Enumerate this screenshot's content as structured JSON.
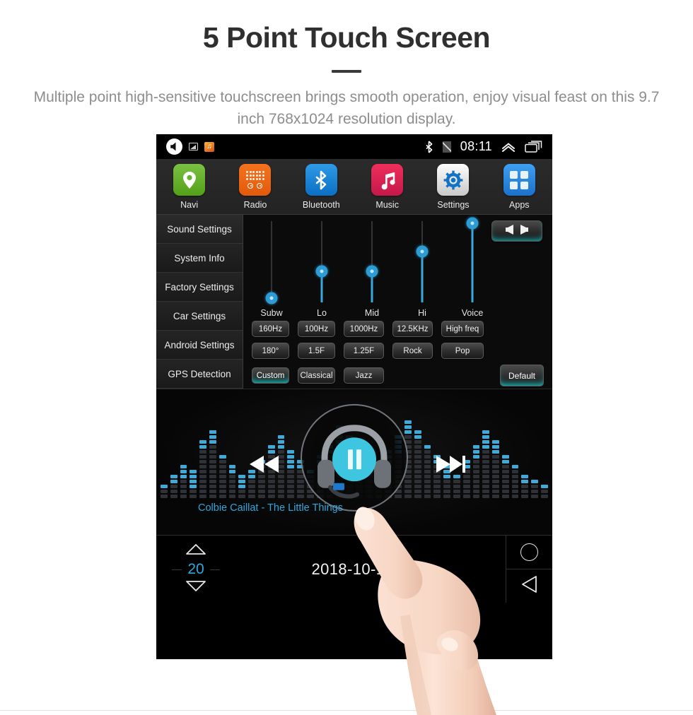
{
  "hero": {
    "title": "5 Point Touch Screen",
    "subtitle": "Multiple point high-sensitive touchscreen brings smooth operation, enjoy visual feast on this 9.7 inch 768x1024 resolution display."
  },
  "colors": {
    "accent_blue": "#2fa8e0",
    "slider_blue": "#2e9cd4",
    "glow_teal": "#1ad0d0",
    "screen_bg": "#000000"
  },
  "device": {
    "statusbar": {
      "mute_icon": "speaker-mute-icon",
      "sd_icon": "sd-card-icon",
      "music_icon": "music-notification-icon",
      "bluetooth_icon": "bluetooth-icon",
      "signal_icon": "no-sim-icon",
      "clock": "08:11",
      "expand_icon": "chevron-up-icon",
      "recents_icon": "recents-icon"
    },
    "apps": [
      {
        "label": "Navi",
        "icon": "location-pin-icon"
      },
      {
        "label": "Radio",
        "icon": "radio-icon"
      },
      {
        "label": "Bluetooth",
        "icon": "bluetooth-icon"
      },
      {
        "label": "Music",
        "icon": "music-note-icon"
      },
      {
        "label": "Settings",
        "icon": "gear-icon"
      },
      {
        "label": "Apps",
        "icon": "app-grid-icon"
      }
    ],
    "sidebar": [
      {
        "label": "Sound Settings",
        "selected": true
      },
      {
        "label": "System Info",
        "selected": false
      },
      {
        "label": "Factory Settings",
        "selected": false
      },
      {
        "label": "Car Settings",
        "selected": false
      },
      {
        "label": "Android Settings",
        "selected": false
      },
      {
        "label": "GPS Detection",
        "selected": false
      }
    ],
    "equalizer": {
      "balance_button_icon": "balance-fader-icon",
      "sliders": [
        {
          "label": "Subw",
          "value": 5
        },
        {
          "label": "Lo",
          "value": 38
        },
        {
          "label": "Mid",
          "value": 38
        },
        {
          "label": "Hi",
          "value": 62
        },
        {
          "label": "Voice",
          "value": 95
        }
      ],
      "preset_rows": [
        [
          {
            "label": "160Hz",
            "active": false
          },
          {
            "label": "100Hz",
            "active": false
          },
          {
            "label": "1000Hz",
            "active": false
          },
          {
            "label": "12.5KHz",
            "active": false
          },
          {
            "label": "High freq",
            "active": false
          }
        ],
        [
          {
            "label": "180°",
            "active": false
          },
          {
            "label": "1.5F",
            "active": false
          },
          {
            "label": "1.25F",
            "active": false
          },
          {
            "label": "Rock",
            "active": false
          },
          {
            "label": "Pop",
            "active": false
          }
        ],
        [
          {
            "label": "Custom",
            "active": true
          },
          {
            "label": "Classical",
            "active": false
          },
          {
            "label": "Jazz",
            "active": false
          }
        ]
      ],
      "default_button": "Default"
    },
    "player": {
      "track": "Colbie Caillat - The Little Things",
      "prev_icon": "previous-track-icon",
      "play_icon": "pause-icon",
      "next_icon": "next-track-icon",
      "artwork_icon": "headphones-icon"
    },
    "bottombar": {
      "volume_up_icon": "triangle-up-icon",
      "volume_value": "20",
      "volume_down_icon": "triangle-down-icon",
      "datetime": "2018-10-15  Mon",
      "home_icon": "home-circle-icon",
      "back_icon": "back-triangle-icon"
    }
  },
  "overlay": {
    "hand_icon": "pointing-hand-icon"
  }
}
